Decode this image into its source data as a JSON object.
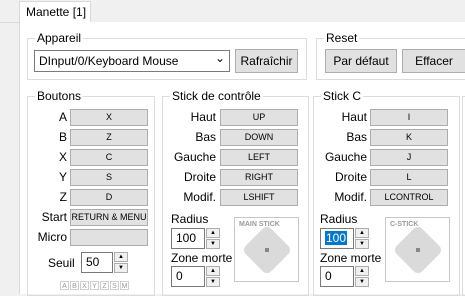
{
  "tabs": [
    {
      "label": "Manette [1]"
    }
  ],
  "device": {
    "title": "Appareil",
    "selected": "DInput/0/Keyboard Mouse",
    "refresh_label": "Rafraîchir"
  },
  "reset": {
    "title": "Reset",
    "default_label": "Par défaut",
    "clear_label": "Effacer"
  },
  "buttons": {
    "title": "Boutons",
    "rows": [
      {
        "name": "A",
        "key": "X"
      },
      {
        "name": "B",
        "key": "Z"
      },
      {
        "name": "X",
        "key": "C"
      },
      {
        "name": "Y",
        "key": "S"
      },
      {
        "name": "Z",
        "key": "D"
      },
      {
        "name": "Start",
        "key": "RETURN & MENU"
      },
      {
        "name": "Micro",
        "key": ""
      }
    ],
    "threshold_label": "Seuil",
    "threshold_value": "50",
    "mini_labels": [
      "A",
      "B",
      "X",
      "Y",
      "Z",
      "S",
      "M"
    ]
  },
  "main_stick": {
    "title": "Stick de contrôle",
    "rows": [
      {
        "name": "Haut",
        "key": "UP"
      },
      {
        "name": "Bas",
        "key": "DOWN"
      },
      {
        "name": "Gauche",
        "key": "LEFT"
      },
      {
        "name": "Droite",
        "key": "RIGHT"
      },
      {
        "name": "Modif.",
        "key": "LSHIFT"
      }
    ],
    "radius_label": "Radius",
    "radius_value": "100",
    "deadzone_label": "Zone morte",
    "deadzone_value": "0",
    "preview_label": "MAIN STICK"
  },
  "c_stick": {
    "title": "Stick C",
    "rows": [
      {
        "name": "Haut",
        "key": "I"
      },
      {
        "name": "Bas",
        "key": "K"
      },
      {
        "name": "Gauche",
        "key": "J"
      },
      {
        "name": "Droite",
        "key": "L"
      },
      {
        "name": "Modif.",
        "key": "LCONTROL"
      }
    ],
    "radius_label": "Radius",
    "radius_value": "100",
    "deadzone_label": "Zone morte",
    "deadzone_value": "0",
    "preview_label": "C-STICK"
  },
  "spin": {
    "up": "▲",
    "down": "▼"
  },
  "combo_arrow": "⌄"
}
